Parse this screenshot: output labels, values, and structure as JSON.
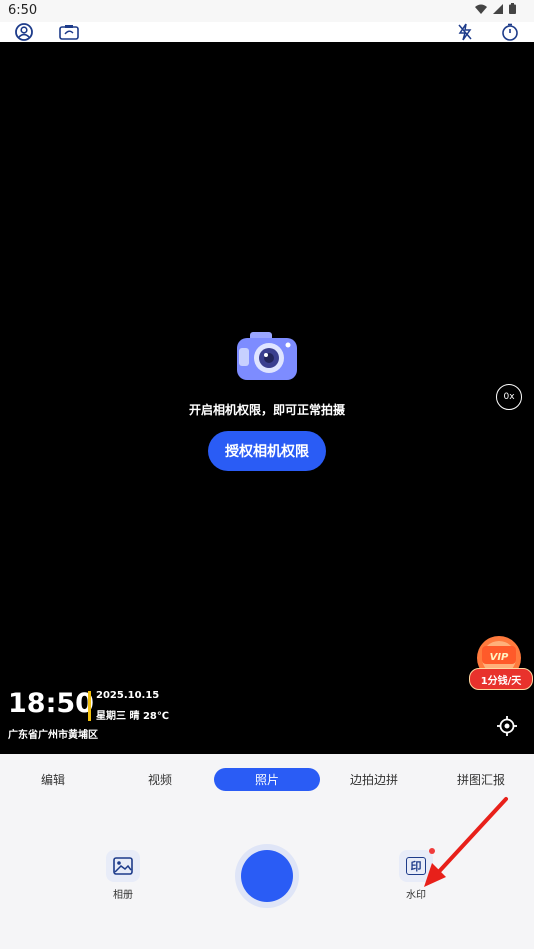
{
  "status_bar": {
    "time": "6:50"
  },
  "viewfinder": {
    "permission_text": "开启相机权限，即可正常拍摄",
    "permission_button": "授权相机权限",
    "zoom_label": "0x",
    "vip_label": "1分钱/天",
    "watermark": {
      "time": "18:50",
      "date": "2025.10.15",
      "weather": "星期三 晴 28℃",
      "location": "广东省广州市黄埔区"
    }
  },
  "mode_tabs": [
    {
      "label": "编辑"
    },
    {
      "label": "视频"
    },
    {
      "label": "照片",
      "active": true
    },
    {
      "label": "边拍边拼"
    },
    {
      "label": "拼图汇报"
    }
  ],
  "bottom": {
    "album_label": "相册",
    "watermark_label": "水印",
    "watermark_icon_char": "印"
  },
  "colors": {
    "accent": "#2a5cf5",
    "watermark_bar": "#f2c10f",
    "vip_red": "#e8322c"
  },
  "icons": [
    "profile-icon",
    "camera-switch-icon",
    "flash-off-icon",
    "timer-icon",
    "wifi-icon",
    "signal-icon",
    "battery-icon",
    "locate-icon",
    "album-icon"
  ]
}
